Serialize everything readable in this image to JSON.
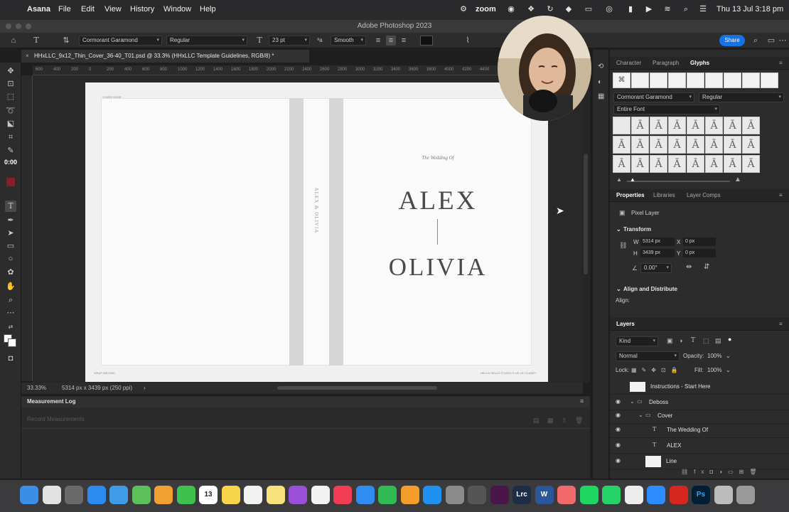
{
  "menubar": {
    "app": "Asana",
    "items": [
      "File",
      "Edit",
      "View",
      "History",
      "Window",
      "Help"
    ],
    "zoom_label": "zoom",
    "datetime": "Thu 13 Jul  3:18 pm"
  },
  "app_title": "Adobe Photoshop 2023",
  "options_bar": {
    "font_family": "Cormorant Garamond",
    "font_style": "Regular",
    "font_size": "23 pt",
    "antialias": "Smooth",
    "share_label": "Share"
  },
  "document": {
    "tab_title": "HHxLLC_9x12_Thin_Cover_36-40_T01.psd @ 33.3% (HHxLLC Template Guidelines, RGB/8) *",
    "pre_title": "The Wedding Of",
    "name1": "ALEX",
    "name2": "OLIVIA",
    "spine_text": "ALEX & OLIVIA",
    "cover_edge_label": "COVER EDGE",
    "wrap_label": "WRAP AROUND",
    "brand_label": "HELLO HELLO STUDIO X LEI LEI CLANEY"
  },
  "ruler_ticks": [
    "600",
    "400",
    "200",
    "0",
    "200",
    "400",
    "600",
    "800",
    "1000",
    "1200",
    "1400",
    "1600",
    "1800",
    "2000",
    "2200",
    "2400",
    "2600",
    "2800",
    "3000",
    "3200",
    "3400",
    "3600",
    "3800",
    "4000",
    "4200",
    "4400"
  ],
  "timer": "0:00",
  "status": {
    "zoom": "33.33%",
    "doc_info": "5314 px x 3439 px (250 ppi)"
  },
  "measurement_log": {
    "title": "Measurement Log",
    "record_button": "Record Measurements"
  },
  "glyphs_panel": {
    "tabs": [
      "Character",
      "Paragraph",
      "Glyphs"
    ],
    "font": "Cormorant Garamond",
    "style": "Regular",
    "filter": "Entire Font",
    "glyph_char": "Ā",
    "glyph_rows": [
      [
        "",
        "Ā",
        "Ā",
        "Ā",
        "Ā",
        "Ā",
        "Ā",
        "Ā"
      ],
      [
        "Ā",
        "Ā",
        "Ā",
        "Ā",
        "Ā",
        "Ā",
        "Ā",
        "Ā"
      ],
      [
        "Ā",
        "Ā",
        "Ā",
        "Ā",
        "Ā",
        "Ā",
        "Ā",
        "Ā"
      ]
    ]
  },
  "properties_panel": {
    "tabs": [
      "Properties",
      "Libraries",
      "Layer Comps"
    ],
    "kind": "Pixel Layer",
    "transform_title": "Transform",
    "w_label": "W",
    "w": "5314 px",
    "h_label": "H",
    "h": "3439 px",
    "x_label": "X",
    "x": "0 px",
    "y_label": "Y",
    "y": "0 px",
    "angle": "0.00°",
    "align_title": "Align and Distribute",
    "align_label": "Align:"
  },
  "layers_panel": {
    "title": "Layers",
    "kind_filter": "Kind",
    "blend_mode": "Normal",
    "opacity_label": "Opacity:",
    "opacity": "100%",
    "lock_label": "Lock:",
    "fill_label": "Fill:",
    "fill": "100%",
    "layers": [
      {
        "name": "Instructions - Start Here",
        "type": "image"
      },
      {
        "name": "Deboss",
        "type": "group"
      },
      {
        "name": "Cover",
        "type": "group"
      },
      {
        "name": "The Wedding Of",
        "type": "text"
      },
      {
        "name": "ALEX",
        "type": "text"
      },
      {
        "name": "Line",
        "type": "image"
      }
    ]
  },
  "dock": {
    "calendar_day": "13",
    "apps": [
      "Finder",
      "Chrome",
      "Launchpad",
      "Safari",
      "Mail",
      "Maps",
      "Photos",
      "Messages",
      "Calendar",
      "Notes",
      "Reminders",
      "Stickies",
      "Podcasts",
      "News",
      "Music",
      "Keynote",
      "Numbers",
      "Pages",
      "App Store",
      "System Settings",
      "Calculator",
      "Slack",
      "Lightroom Classic",
      "Word",
      "Asana",
      "Spotify",
      "WhatsApp",
      "TextEdit",
      "Zoom",
      "Acrobat",
      "Photoshop",
      "Downloads",
      "Trash"
    ],
    "lrc_label": "Lrc",
    "ps_label": "Ps",
    "word_label": "W"
  },
  "colors": {
    "accent": "#1473e6",
    "foreground_swatch": "#8a1f2b"
  }
}
